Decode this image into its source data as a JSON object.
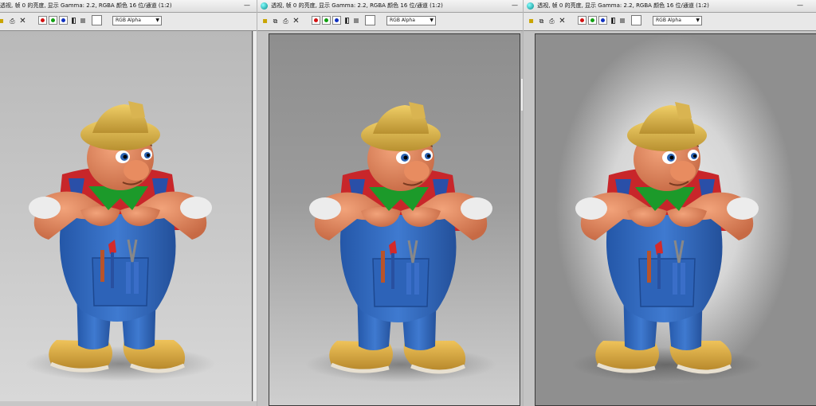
{
  "windows": [
    {
      "title": "透视, 帧 0 的亮度, 显示 Gamma: 2.2, RGBA 颜色 16 位/通道 (1:2)",
      "channel": "RGB Alpha"
    },
    {
      "title": "透视, 帧 0 的亮度, 显示 Gamma: 2.2, RGBA 颜色 16 位/通道 (1:2)",
      "channel": "RGB Alpha"
    },
    {
      "title": "透视, 帧 0 的亮度, 显示 Gamma: 2.2, RGBA 颜色 16 位/通道 (1:2)",
      "channel": "RGB Alpha"
    }
  ],
  "icons": {
    "title": "app-icon",
    "save": "save-icon",
    "copy": "copy-icon",
    "print": "print-icon",
    "clear": "clear-icon",
    "red": "red-channel-icon",
    "green": "green-channel-icon",
    "blue": "blue-channel-icon",
    "mono": "monochrome-icon",
    "color_swatch": "color-swatch"
  },
  "colors": {
    "red": "#d31010",
    "green": "#10a010",
    "blue": "#1030c0"
  },
  "window_buttons": {
    "minimize": "—",
    "close": "✕"
  }
}
